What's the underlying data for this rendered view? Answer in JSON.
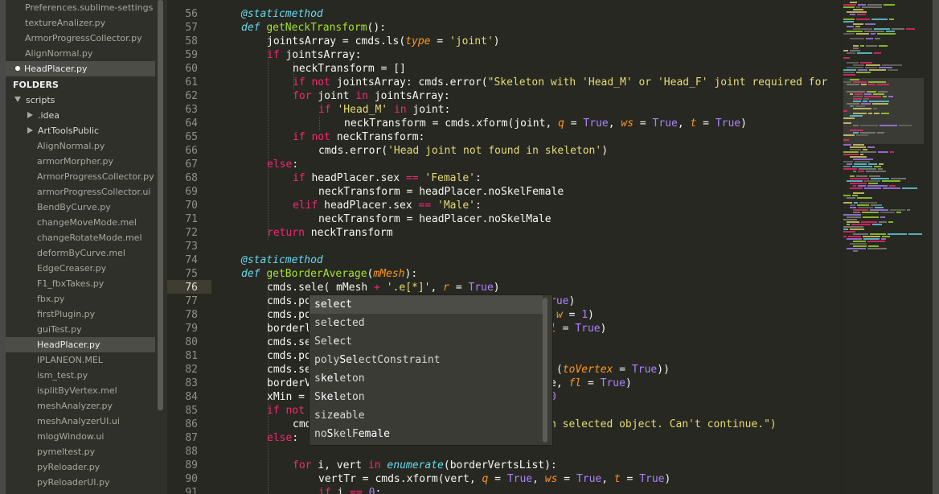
{
  "sidebar": {
    "open_files": [
      "Preferences.sublime-settings",
      "textureAnalizer.py",
      "ArmorProgressCollector.py",
      "AlignNormal.py",
      "HeadPlacer.py"
    ],
    "folders_label": "FOLDERS",
    "root_folder": "scripts",
    "subfolders": [
      ".idea",
      "ArtToolsPublic"
    ],
    "files": [
      "AlignNormal.py",
      "armorMorpher.py",
      "ArmorProgressCollector.py",
      "armorProgressCollector.ui",
      "BendByCurve.py",
      "changeMoveMode.mel",
      "changeRotateMode.mel",
      "deformByCurve.mel",
      "EdgeCreaser.py",
      "F1_fbxTakes.py",
      "fbx.py",
      "firstPlugin.py",
      "guiTest.py",
      "HeadPlacer.py",
      "IPLANEON.MEL",
      "ism_test.py",
      "isplitByVertex.mel",
      "meshAnalyzer.py",
      "meshAnalyzerUI.ui",
      "mlogWindow.ui",
      "pymeltest.py",
      "pyReloader.py",
      "pyReloaderUI.py"
    ]
  },
  "editor": {
    "line_numbers": [
      "56",
      "57",
      "58",
      "59",
      "60",
      "61",
      "62",
      "63",
      "64",
      "65",
      "66",
      "67",
      "68",
      "69",
      "70",
      "71",
      "72",
      "73",
      "74",
      "75",
      "76",
      "77",
      "78",
      "79",
      "80",
      "81",
      "82",
      "83",
      "84",
      "85",
      "86",
      "87",
      "88",
      "89",
      "90",
      "91"
    ],
    "current_line": "76"
  },
  "code": {
    "l56a": "@staticmethod",
    "l57a": "def",
    "l57b": " ",
    "l57c": "getNeckTransform",
    "l57d": "():",
    "l58a": "jointsArray = cmds.ls(",
    "l58b": "type",
    "l58c": " = ",
    "l58d": "'joint'",
    "l58e": ")",
    "l59a": "if",
    "l59b": " jointsArray:",
    "l60a": "neckTransform = []",
    "l61a": "if not",
    "l61b": " jointsArray: cmds.error(",
    "l61c": "\"Skeleton with 'Head_M' or 'Head_F' joint required for",
    "l62a": "for",
    "l62b": " joint ",
    "l62c": "in",
    "l62d": " jointsArray:",
    "l63a": "if",
    "l63b": " ",
    "l63c": "'Head_M'",
    "l63d": " ",
    "l63e": "in",
    "l63f": " joint:",
    "l64a": "neckTransform = cmds.xform(joint, ",
    "l64b": "q",
    "l64c": " = ",
    "l64d": "True",
    "l64e": ", ",
    "l64f": "ws",
    "l64g": " = ",
    "l64h": "True",
    "l64i": ", ",
    "l64j": "t",
    "l64k": " = ",
    "l64l": "True",
    "l64m": ")",
    "l65a": "if not",
    "l65b": " neckTransform:",
    "l66a": "cmds.error(",
    "l66b": "'Head joint not found in skeleton'",
    "l66c": ")",
    "l67a": "else",
    "l67b": ":",
    "l68a": "if",
    "l68b": " headPlacer.sex ",
    "l68c": "==",
    "l68d": " ",
    "l68e": "'Female'",
    "l68f": ":",
    "l69a": "neckTransform = headPlacer.noSkelFemale",
    "l70a": "elif",
    "l70b": " headPlacer.sex ",
    "l70c": "==",
    "l70d": " ",
    "l70e": "'Male'",
    "l70f": ":",
    "l71a": "neckTransform = headPlacer.noSkelMale",
    "l72a": "return",
    "l72b": " neckTransform",
    "l74a": "@staticmethod",
    "l75a": "def",
    "l75b": " ",
    "l75c": "getBorderAverage",
    "l75d": "(",
    "l75e": "mMesh",
    "l75f": "):",
    "l76a": "cmds.sele( mMesh ",
    "l76b": "+",
    "l76c": " ",
    "l76d": "'.e[*]'",
    "l76e": ", ",
    "l76f": "r",
    "l76g": " = ",
    "l76h": "True",
    "l76i": ")",
    "l77a": "cmds.po",
    "l77b": "rue",
    "l77c": ")",
    "l78a": "cmds.po",
    "l78b": "w",
    "l78c": " = ",
    "l78d": "1",
    "l78e": ")",
    "l79a": "borderl",
    "l79b": "l",
    "l79c": " = ",
    "l79d": "True",
    "l79e": ")",
    "l80a": "cmds.se",
    "l81a": "cmds.po",
    "l82a": "cmds.se",
    "l82b": "(",
    "l82c": "toVertex",
    "l82d": " = ",
    "l82e": "True",
    "l82f": "))",
    "l83a": "borderV",
    "l83b": "e, ",
    "l83c": "fl",
    "l83d": " = ",
    "l83e": "True",
    "l83f": ")",
    "l84a": "xMin = ",
    "l84b": "0",
    "l85a": "if not",
    "l86a": "cmd",
    "l86b": "n selected object. Can't continue.\")",
    "l87a": "else",
    "l87b": ":",
    "l89a": "for",
    "l89b": " i, vert ",
    "l89c": "in",
    "l89d": " ",
    "l89e": "enumerate",
    "l89f": "(borderVertsList):",
    "l90a": "vertTr = cmds.xform(vert, ",
    "l90b": "q",
    "l90c": " = ",
    "l90d": "True",
    "l90e": ", ",
    "l90f": "ws",
    "l90g": " = ",
    "l90h": "True",
    "l90i": ", ",
    "l90j": "t",
    "l90k": " = ",
    "l90l": "True",
    "l90m": ")",
    "l91a": "if",
    "l91b": " i ",
    "l91c": "==",
    "l91d": " ",
    "l91e": "0",
    "l91f": ":"
  },
  "autocomplete": {
    "items": [
      [
        "sel",
        "e",
        "ct",
        ""
      ],
      [
        "sel",
        "e",
        "cted",
        ""
      ],
      [
        "Sel",
        "e",
        "ct",
        ""
      ],
      [
        "poly",
        "Sel",
        "ectConstraint",
        ""
      ],
      [
        "s",
        "kel",
        "eton",
        ""
      ],
      [
        "S",
        "kel",
        "eton",
        ""
      ],
      [
        "siz",
        "e",
        "able",
        ""
      ],
      [
        "no",
        "S",
        "kelF",
        "emale"
      ]
    ]
  },
  "colors": {
    "background": "#272822",
    "keyword": "#f92672",
    "function": "#a6e22e",
    "string": "#e6db74",
    "parameter": "#fd971f",
    "constant": "#ae81ff",
    "decorator": "#66d9ef"
  }
}
